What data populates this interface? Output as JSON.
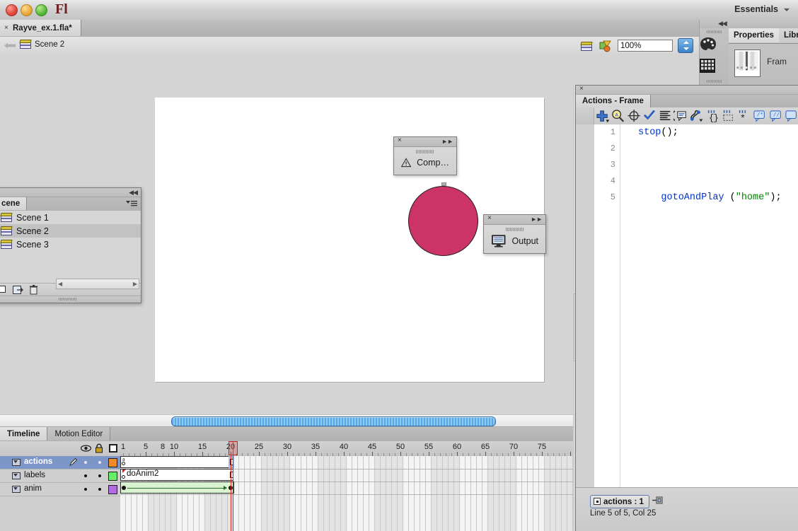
{
  "titlebar": {
    "app_initials": "Fl",
    "workspace": "Essentials",
    "traffic_lights": [
      "close-button",
      "minimize-button",
      "maximize-button"
    ]
  },
  "document_tab": {
    "close_glyph": "×",
    "filename": "Rayve_ex.1.fla*"
  },
  "editbar": {
    "scene_name": "Scene 2",
    "zoom_value": "100%",
    "icons": [
      "edit-scene-icon",
      "edit-symbols-icon"
    ]
  },
  "stage": {
    "shape_color": "#cc3366",
    "background": "#ffffff"
  },
  "mini_panels": [
    {
      "name": "compiler-errors",
      "label": "Comp…",
      "icon": "warning-triangle-icon"
    },
    {
      "name": "output",
      "label": "Output",
      "icon": "monitor-icon"
    }
  ],
  "scene_panel": {
    "tab_label": "cene",
    "items": [
      {
        "label": "Scene 1",
        "selected": false
      },
      {
        "label": "Scene 2",
        "selected": true
      },
      {
        "label": "Scene 3",
        "selected": false
      }
    ],
    "footer_buttons": [
      "duplicate-scene-icon",
      "add-scene-icon",
      "delete-scene-icon"
    ]
  },
  "timeline": {
    "tabs": [
      {
        "label": "Timeline",
        "active": true
      },
      {
        "label": "Motion Editor",
        "active": false
      }
    ],
    "column_headers": [
      "eye-icon",
      "lock-icon",
      "outline-icon"
    ],
    "ruler_numbers": [
      1,
      5,
      10,
      15,
      20,
      25,
      30,
      35,
      40,
      45,
      50,
      55,
      60,
      65,
      70,
      75,
      8
    ],
    "playhead_frame": 20,
    "layers": [
      {
        "name": "actions",
        "color": "#f08a2a",
        "selected": true,
        "editing": true
      },
      {
        "name": "labels",
        "color": "#66ee66",
        "selected": false,
        "editing": false
      },
      {
        "name": "anim",
        "color": "#b26be0",
        "selected": false,
        "editing": false
      }
    ],
    "frame_label_text": "doAnim2",
    "span_start_frame": 1,
    "span_end_frame": 20
  },
  "right_dock": {
    "icon_buttons": [
      "color-palette-icon",
      "swatches-grid-icon"
    ],
    "tabs": [
      {
        "label": "Properties",
        "active": true
      },
      {
        "label": "Libra",
        "active": false
      }
    ],
    "properties_title": "Fram"
  },
  "actions_panel": {
    "tab_label": "Actions - Frame",
    "toolbar_icons": [
      "add-item-icon",
      "find-icon",
      "insert-target-path-icon",
      "check-syntax-icon",
      "auto-format-icon",
      "show-code-hint-icon",
      "debug-options-icon",
      "collapse-between-braces-icon",
      "collapse-selection-icon",
      "expand-all-icon",
      "apply-block-comment-icon",
      "apply-line-comment-icon",
      "remove-comment-icon"
    ],
    "code_lines": [
      {
        "n": 1,
        "tokens": [
          {
            "t": "kw",
            "v": "stop"
          },
          {
            "t": "pl",
            "v": "();"
          }
        ]
      },
      {
        "n": 2,
        "tokens": []
      },
      {
        "n": 3,
        "tokens": []
      },
      {
        "n": 4,
        "tokens": []
      },
      {
        "n": 5,
        "tokens": [
          {
            "t": "kw",
            "v": "    gotoAndPlay"
          },
          {
            "t": "pl",
            "v": " ("
          },
          {
            "t": "str",
            "v": "\"home\""
          },
          {
            "t": "pl",
            "v": ");"
          }
        ]
      }
    ],
    "script_chip": "actions : 1",
    "status_text": "Line 5 of 5, Col 25"
  }
}
